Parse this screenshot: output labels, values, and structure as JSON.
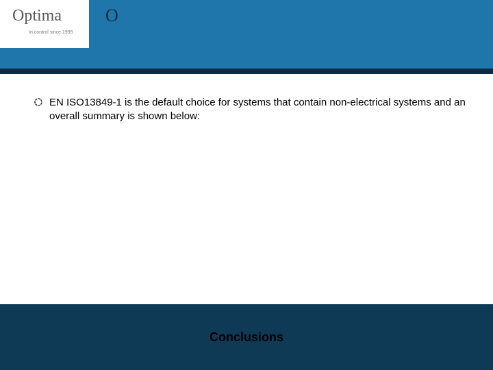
{
  "brand": {
    "name": "Optima",
    "tagline": "In control since 1995",
    "mark": "O"
  },
  "content": {
    "bullets": [
      "EN ISO13849-1 is the default choice for systems that contain non-electrical systems and an overall summary is shown below:"
    ]
  },
  "footer": {
    "title": "Conclusions"
  },
  "colors": {
    "topBand": "#1f76aa",
    "divider": "#0e2b44",
    "bottomBand": "#0e3a56"
  }
}
